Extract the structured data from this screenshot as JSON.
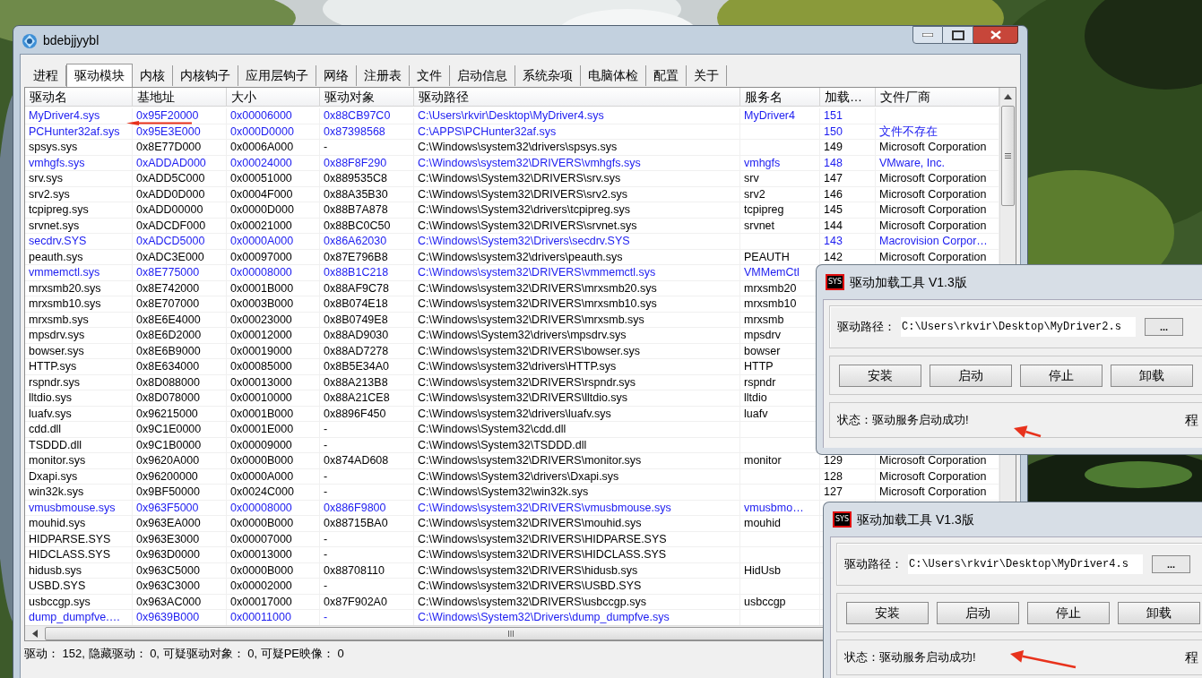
{
  "window": {
    "title": "bdebjjyybl"
  },
  "tabs": [
    {
      "label": "进程",
      "selected": false
    },
    {
      "label": "驱动模块",
      "selected": true
    },
    {
      "label": "内核",
      "selected": false
    },
    {
      "label": "内核钩子",
      "selected": false
    },
    {
      "label": "应用层钩子",
      "selected": false
    },
    {
      "label": "网络",
      "selected": false
    },
    {
      "label": "注册表",
      "selected": false
    },
    {
      "label": "文件",
      "selected": false
    },
    {
      "label": "启动信息",
      "selected": false
    },
    {
      "label": "系统杂项",
      "selected": false
    },
    {
      "label": "电脑体检",
      "selected": false
    },
    {
      "label": "配置",
      "selected": false
    },
    {
      "label": "关于",
      "selected": false
    }
  ],
  "table": {
    "columns": [
      "驱动名",
      "基地址",
      "大小",
      "驱动对象",
      "驱动路径",
      "服务名",
      "加载…",
      "文件厂商"
    ],
    "rows": [
      {
        "flagged": true,
        "name": "MyDriver4.sys",
        "base": "0x95F20000",
        "size": "0x00006000",
        "object": "0x88CB97C0",
        "path": "C:\\Users\\rkvir\\Desktop\\MyDriver4.sys",
        "service": "MyDriver4",
        "order": "151"
      },
      {
        "flagged": true,
        "name": "PCHunter32af.sys",
        "base": "0x95E3E000",
        "size": "0x000D0000",
        "object": "0x87398568",
        "path": "C:\\APPS\\PCHunter32af.sys",
        "order": "150",
        "vendor": "文件不存在"
      },
      {
        "flagged": false,
        "name": "spsys.sys",
        "base": "0x8E77D000",
        "size": "0x0006A000",
        "object": "-",
        "path": "C:\\Windows\\system32\\drivers\\spsys.sys",
        "order": "149",
        "vendor": "Microsoft Corporation"
      },
      {
        "flagged": true,
        "name": "vmhgfs.sys",
        "base": "0xADDAD000",
        "size": "0x00024000",
        "object": "0x88F8F290",
        "path": "C:\\Windows\\system32\\DRIVERS\\vmhgfs.sys",
        "service": "vmhgfs",
        "order": "148",
        "vendor": "VMware, Inc."
      },
      {
        "flagged": false,
        "name": "srv.sys",
        "base": "0xADD5C000",
        "size": "0x00051000",
        "object": "0x889535C8",
        "path": "C:\\Windows\\System32\\DRIVERS\\srv.sys",
        "service": "srv",
        "order": "147",
        "vendor": "Microsoft Corporation"
      },
      {
        "flagged": false,
        "name": "srv2.sys",
        "base": "0xADD0D000",
        "size": "0x0004F000",
        "object": "0x88A35B30",
        "path": "C:\\Windows\\System32\\DRIVERS\\srv2.sys",
        "service": "srv2",
        "order": "146",
        "vendor": "Microsoft Corporation"
      },
      {
        "flagged": false,
        "name": "tcpipreg.sys",
        "base": "0xADD00000",
        "size": "0x0000D000",
        "object": "0x88B7A878",
        "path": "C:\\Windows\\System32\\drivers\\tcpipreg.sys",
        "service": "tcpipreg",
        "order": "145",
        "vendor": "Microsoft Corporation"
      },
      {
        "flagged": false,
        "name": "srvnet.sys",
        "base": "0xADCDF000",
        "size": "0x00021000",
        "object": "0x88BC0C50",
        "path": "C:\\Windows\\System32\\DRIVERS\\srvnet.sys",
        "service": "srvnet",
        "order": "144",
        "vendor": "Microsoft Corporation"
      },
      {
        "flagged": true,
        "name": "secdrv.SYS",
        "base": "0xADCD5000",
        "size": "0x0000A000",
        "object": "0x86A62030",
        "path": "C:\\Windows\\System32\\Drivers\\secdrv.SYS",
        "order": "143",
        "vendor": "Macrovision Corpor…"
      },
      {
        "flagged": false,
        "name": "peauth.sys",
        "base": "0xADC3E000",
        "size": "0x00097000",
        "object": "0x87E796B8",
        "path": "C:\\Windows\\system32\\drivers\\peauth.sys",
        "service": "PEAUTH",
        "order": "142",
        "vendor": "Microsoft Corporation"
      },
      {
        "flagged": true,
        "name": "vmmemctl.sys",
        "base": "0x8E775000",
        "size": "0x00008000",
        "object": "0x88B1C218",
        "path": "C:\\Windows\\system32\\DRIVERS\\vmmemctl.sys",
        "service": "VMMemCtl"
      },
      {
        "flagged": false,
        "name": "mrxsmb20.sys",
        "base": "0x8E742000",
        "size": "0x0001B000",
        "object": "0x88AF9C78",
        "path": "C:\\Windows\\system32\\DRIVERS\\mrxsmb20.sys",
        "service": "mrxsmb20"
      },
      {
        "flagged": false,
        "name": "mrxsmb10.sys",
        "base": "0x8E707000",
        "size": "0x0003B000",
        "object": "0x8B074E18",
        "path": "C:\\Windows\\system32\\DRIVERS\\mrxsmb10.sys",
        "service": "mrxsmb10"
      },
      {
        "flagged": false,
        "name": "mrxsmb.sys",
        "base": "0x8E6E4000",
        "size": "0x00023000",
        "object": "0x8B0749E8",
        "path": "C:\\Windows\\system32\\DRIVERS\\mrxsmb.sys",
        "service": "mrxsmb"
      },
      {
        "flagged": false,
        "name": "mpsdrv.sys",
        "base": "0x8E6D2000",
        "size": "0x00012000",
        "object": "0x88AD9030",
        "path": "C:\\Windows\\System32\\drivers\\mpsdrv.sys",
        "service": "mpsdrv"
      },
      {
        "flagged": false,
        "name": "bowser.sys",
        "base": "0x8E6B9000",
        "size": "0x00019000",
        "object": "0x88AD7278",
        "path": "C:\\Windows\\system32\\DRIVERS\\bowser.sys",
        "service": "bowser"
      },
      {
        "flagged": false,
        "name": "HTTP.sys",
        "base": "0x8E634000",
        "size": "0x00085000",
        "object": "0x8B5E34A0",
        "path": "C:\\Windows\\system32\\drivers\\HTTP.sys",
        "service": "HTTP"
      },
      {
        "flagged": false,
        "name": "rspndr.sys",
        "base": "0x8D088000",
        "size": "0x00013000",
        "object": "0x88A213B8",
        "path": "C:\\Windows\\system32\\DRIVERS\\rspndr.sys",
        "service": "rspndr"
      },
      {
        "flagged": false,
        "name": "lltdio.sys",
        "base": "0x8D078000",
        "size": "0x00010000",
        "object": "0x88A21CE8",
        "path": "C:\\Windows\\system32\\DRIVERS\\lltdio.sys",
        "service": "lltdio"
      },
      {
        "flagged": false,
        "name": "luafv.sys",
        "base": "0x96215000",
        "size": "0x0001B000",
        "object": "0x8896F450",
        "path": "C:\\Windows\\system32\\drivers\\luafv.sys",
        "service": "luafv"
      },
      {
        "flagged": false,
        "name": "cdd.dll",
        "base": "0x9C1E0000",
        "size": "0x0001E000",
        "object": "-",
        "path": "C:\\Windows\\System32\\cdd.dll"
      },
      {
        "flagged": false,
        "name": "TSDDD.dll",
        "base": "0x9C1B0000",
        "size": "0x00009000",
        "object": "-",
        "path": "C:\\Windows\\System32\\TSDDD.dll"
      },
      {
        "flagged": false,
        "name": "monitor.sys",
        "base": "0x9620A000",
        "size": "0x0000B000",
        "object": "0x874AD608",
        "path": "C:\\Windows\\system32\\DRIVERS\\monitor.sys",
        "service": "monitor",
        "order": "129",
        "vendor": "Microsoft Corporation"
      },
      {
        "flagged": false,
        "name": "Dxapi.sys",
        "base": "0x96200000",
        "size": "0x0000A000",
        "object": "-",
        "path": "C:\\Windows\\System32\\drivers\\Dxapi.sys",
        "order": "128",
        "vendor": "Microsoft Corporation"
      },
      {
        "flagged": false,
        "name": "win32k.sys",
        "base": "0x9BF50000",
        "size": "0x0024C000",
        "object": "-",
        "path": "C:\\Windows\\System32\\win32k.sys",
        "order": "127",
        "vendor": "Microsoft Corporation"
      },
      {
        "flagged": true,
        "name": "vmusbmouse.sys",
        "base": "0x963F5000",
        "size": "0x00008000",
        "object": "0x886F9800",
        "path": "C:\\Windows\\system32\\DRIVERS\\vmusbmouse.sys",
        "service": "vmusbmo…"
      },
      {
        "flagged": false,
        "name": "mouhid.sys",
        "base": "0x963EA000",
        "size": "0x0000B000",
        "object": "0x88715BA0",
        "path": "C:\\Windows\\system32\\DRIVERS\\mouhid.sys",
        "service": "mouhid"
      },
      {
        "flagged": false,
        "name": "HIDPARSE.SYS",
        "base": "0x963E3000",
        "size": "0x00007000",
        "object": "-",
        "path": "C:\\Windows\\system32\\DRIVERS\\HIDPARSE.SYS"
      },
      {
        "flagged": false,
        "name": "HIDCLASS.SYS",
        "base": "0x963D0000",
        "size": "0x00013000",
        "object": "-",
        "path": "C:\\Windows\\system32\\DRIVERS\\HIDCLASS.SYS"
      },
      {
        "flagged": false,
        "name": "hidusb.sys",
        "base": "0x963C5000",
        "size": "0x0000B000",
        "object": "0x88708110",
        "path": "C:\\Windows\\system32\\DRIVERS\\hidusb.sys",
        "service": "HidUsb"
      },
      {
        "flagged": false,
        "name": "USBD.SYS",
        "base": "0x963C3000",
        "size": "0x00002000",
        "object": "-",
        "path": "C:\\Windows\\system32\\DRIVERS\\USBD.SYS"
      },
      {
        "flagged": false,
        "name": "usbccgp.sys",
        "base": "0x963AC000",
        "size": "0x00017000",
        "object": "0x87F902A0",
        "path": "C:\\Windows\\system32\\DRIVERS\\usbccgp.sys",
        "service": "usbccgp"
      },
      {
        "flagged": true,
        "name": "dump_dumpfve.…",
        "base": "0x9639B000",
        "size": "0x00011000",
        "object": "-",
        "path": "C:\\Windows\\System32\\Drivers\\dump_dumpfve.sys"
      }
    ]
  },
  "status_bar": "驱动： 152, 隐藏驱动： 0, 可疑驱动对象： 0, 可疑PE映像： 0",
  "dialogs": [
    {
      "icon_text": "SYS",
      "title": "驱动加载工具 V1.3版",
      "path_label": "驱动路径：",
      "path_value": "C:\\Users\\rkvir\\Desktop\\MyDriver2.s",
      "browse": "...",
      "buttons": [
        "安装",
        "启动",
        "停止",
        "卸载"
      ],
      "status": "状态：驱动服务启动成功!",
      "side_text": "程"
    },
    {
      "icon_text": "SYS",
      "title": "驱动加载工具 V1.3版",
      "path_label": "驱动路径：",
      "path_value": "C:\\Users\\rkvir\\Desktop\\MyDriver4.s",
      "browse": "...",
      "buttons": [
        "安装",
        "启动",
        "停止",
        "卸载"
      ],
      "status": "状态：驱动服务启动成功!",
      "side_text": "程"
    }
  ]
}
